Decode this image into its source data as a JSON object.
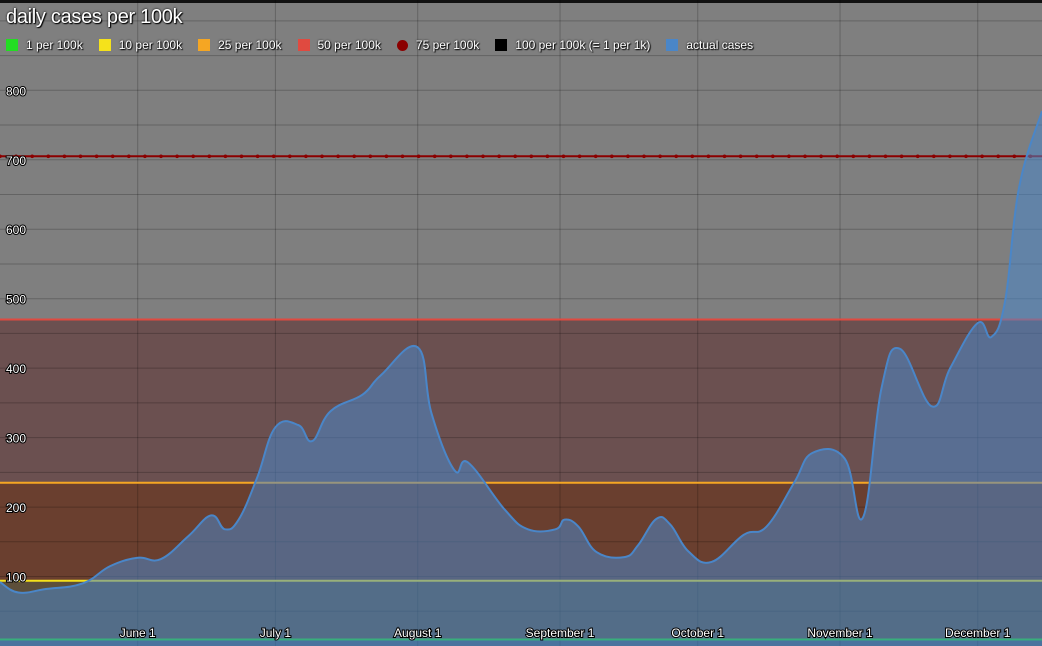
{
  "chart_data": {
    "type": "area",
    "title": "daily cases per 100k",
    "xlabel": "",
    "ylabel": "",
    "x_ticks": [
      {
        "label": "June 1",
        "date": "2020-06-01"
      },
      {
        "label": "July 1",
        "date": "2020-07-01"
      },
      {
        "label": "August 1",
        "date": "2020-08-01"
      },
      {
        "label": "September 1",
        "date": "2020-09-01"
      },
      {
        "label": "October 1",
        "date": "2020-10-01"
      },
      {
        "label": "November 1",
        "date": "2020-11-01"
      },
      {
        "label": "December 1",
        "date": "2020-12-01"
      }
    ],
    "xlim": [
      "2020-05-02",
      "2020-12-15"
    ],
    "y_ticks": [
      100,
      200,
      300,
      400,
      500,
      600,
      700,
      800
    ],
    "ylim": [
      0,
      930
    ],
    "grid": true,
    "legend_position": "top",
    "thresholds": [
      {
        "name": "1 per 100k",
        "value": 9.4,
        "color": "#22dd22",
        "marker": "square",
        "band": "#4a5c6b"
      },
      {
        "name": "10 per 100k",
        "value": 94,
        "color": "#f5e21b",
        "marker": "square",
        "band": "#5d4f3a"
      },
      {
        "name": "25 per 100k",
        "value": 235,
        "color": "#f5a623",
        "marker": "square",
        "band": "#6a3f2f"
      },
      {
        "name": "50 per 100k",
        "value": 470,
        "color": "#e04a40",
        "marker": "square",
        "band": "#6b5050"
      },
      {
        "name": "75 per 100k",
        "value": 705,
        "color": "#8b0000",
        "marker": "dot",
        "band": "#7f7f7f"
      },
      {
        "name": "100 per 100k (= 1 per 1k)",
        "value": 940,
        "color": "#000000",
        "marker": "square",
        "band": null
      }
    ],
    "series": [
      {
        "name": "actual cases",
        "color": "#4a86c8",
        "x": [
          "2020-05-02",
          "2020-05-06",
          "2020-05-12",
          "2020-05-20",
          "2020-05-26",
          "2020-06-01",
          "2020-06-06",
          "2020-06-12",
          "2020-06-17",
          "2020-06-20",
          "2020-06-23",
          "2020-06-27",
          "2020-07-01",
          "2020-07-06",
          "2020-07-09",
          "2020-07-13",
          "2020-07-20",
          "2020-07-24",
          "2020-08-01",
          "2020-08-04",
          "2020-08-09",
          "2020-08-12",
          "2020-08-20",
          "2020-08-25",
          "2020-08-31",
          "2020-09-02",
          "2020-09-05",
          "2020-09-09",
          "2020-09-15",
          "2020-09-18",
          "2020-09-22",
          "2020-09-25",
          "2020-09-29",
          "2020-10-04",
          "2020-10-11",
          "2020-10-16",
          "2020-10-22",
          "2020-10-26",
          "2020-11-02",
          "2020-11-06",
          "2020-11-10",
          "2020-11-14",
          "2020-11-21",
          "2020-11-25",
          "2020-12-01",
          "2020-12-04",
          "2020-12-07",
          "2020-12-10",
          "2020-12-15"
        ],
        "values": [
          92,
          77,
          82,
          90,
          115,
          127,
          125,
          158,
          188,
          168,
          182,
          242,
          315,
          318,
          295,
          338,
          362,
          390,
          430,
          335,
          253,
          264,
          196,
          168,
          168,
          182,
          172,
          135,
          128,
          145,
          183,
          175,
          136,
          121,
          160,
          172,
          235,
          278,
          270,
          185,
          370,
          428,
          345,
          400,
          465,
          445,
          498,
          660,
          770
        ]
      }
    ]
  }
}
